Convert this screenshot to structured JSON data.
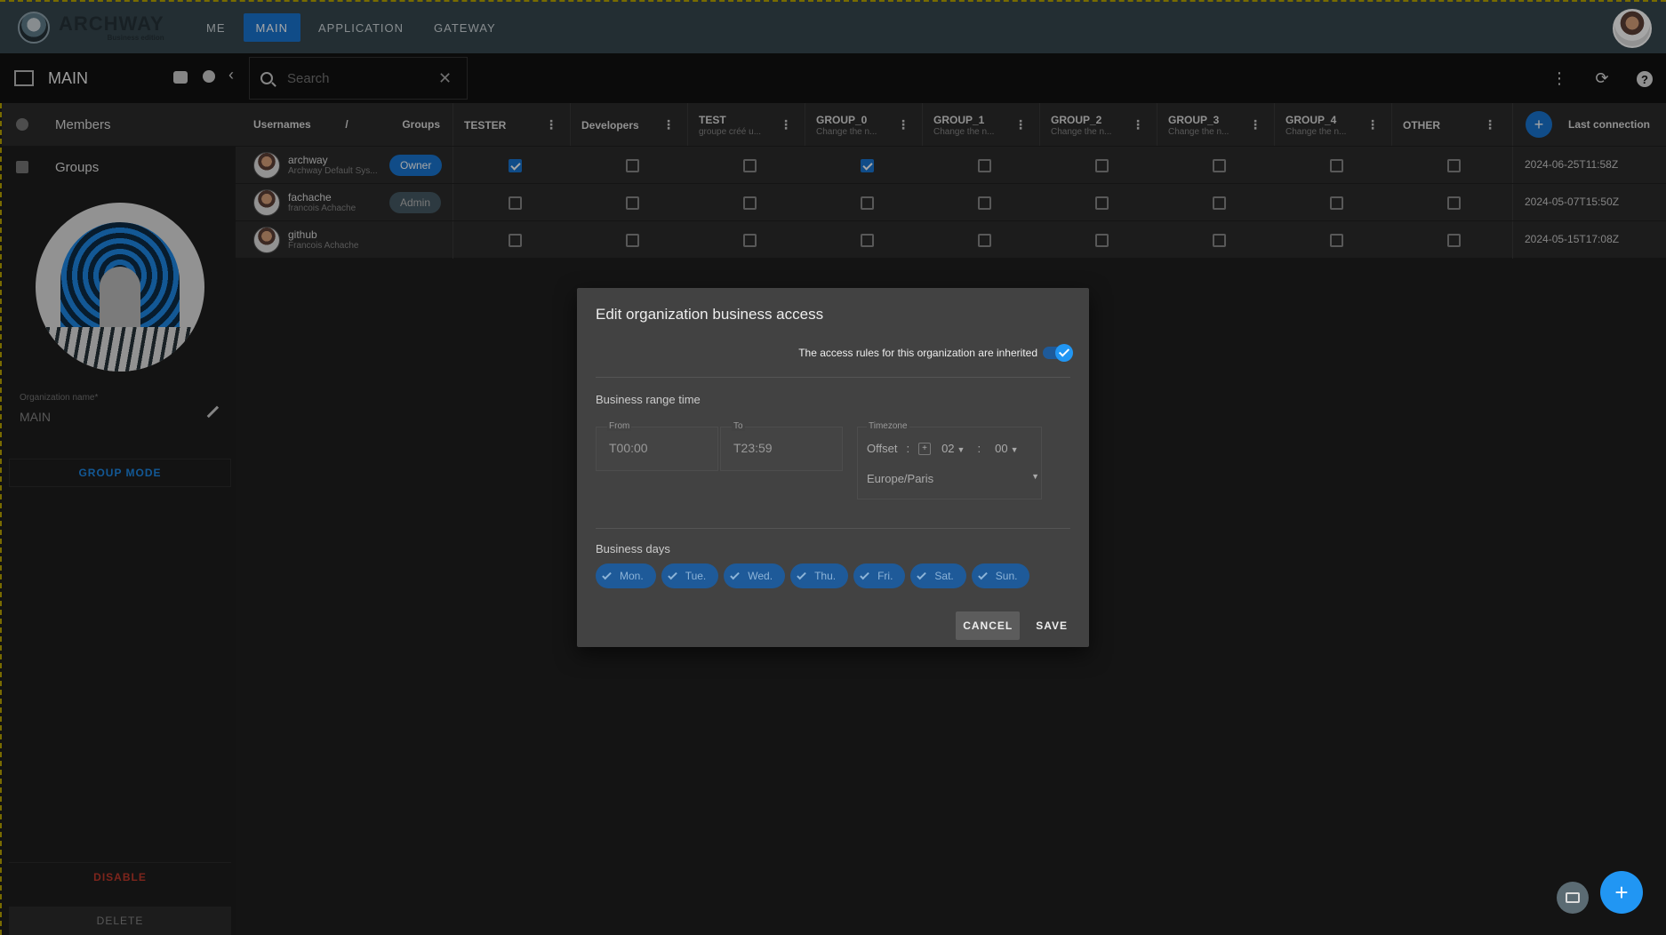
{
  "brand": {
    "name": "ARCHWAY",
    "edition": "Business edition"
  },
  "nav_tabs": [
    {
      "label": "ME"
    },
    {
      "label": "MAIN"
    },
    {
      "label": "APPLICATION"
    },
    {
      "label": "GATEWAY"
    }
  ],
  "subbar": {
    "title": "MAIN",
    "search_placeholder": "Search"
  },
  "sidebar": {
    "items": [
      {
        "label": "Members"
      },
      {
        "label": "Groups"
      }
    ],
    "org_name_label": "Organization name*",
    "org_name_value": "MAIN",
    "group_mode": "GROUP MODE",
    "disable": "DISABLE",
    "delete": "DELETE"
  },
  "table": {
    "col_usernames": "Usernames",
    "col_slash": "/",
    "col_groups": "Groups",
    "groups": [
      {
        "name": "TESTER",
        "sub": ""
      },
      {
        "name": "Developers",
        "sub": ""
      },
      {
        "name": "TEST",
        "sub": "groupe créé u..."
      },
      {
        "name": "GROUP_0",
        "sub": "Change the n..."
      },
      {
        "name": "GROUP_1",
        "sub": "Change the n..."
      },
      {
        "name": "GROUP_2",
        "sub": "Change the n..."
      },
      {
        "name": "GROUP_3",
        "sub": "Change the n..."
      },
      {
        "name": "GROUP_4",
        "sub": "Change the n..."
      },
      {
        "name": "OTHER",
        "sub": ""
      }
    ],
    "last_connection": "Last connection",
    "rows": [
      {
        "username": "archway",
        "sub": "Archway Default Sys...",
        "role": "Owner",
        "checks": [
          true,
          false,
          false,
          true,
          false,
          false,
          false,
          false,
          false
        ],
        "last": "2024-06-25T11:58Z"
      },
      {
        "username": "fachache",
        "sub": "francois Achache",
        "role": "Admin",
        "checks": [
          false,
          false,
          false,
          false,
          false,
          false,
          false,
          false,
          false
        ],
        "last": "2024-05-07T15:50Z"
      },
      {
        "username": "github",
        "sub": "Francois Achache",
        "role": "",
        "checks": [
          false,
          false,
          false,
          false,
          false,
          false,
          false,
          false,
          false
        ],
        "last": "2024-05-15T17:08Z"
      }
    ]
  },
  "dialog": {
    "title": "Edit organization business access",
    "inherited_text": "The access rules for this organization are inherited",
    "inherited": true,
    "range_title": "Business range time",
    "from_label": "From",
    "from_value": "T00:00",
    "to_label": "To",
    "to_value": "T23:59",
    "tz_label": "Timezone",
    "offset_label": "Offset",
    "offset_sign": "+",
    "offset_hours": "02",
    "offset_minutes": "00",
    "colon": ":",
    "zone": "Europe/Paris",
    "days_title": "Business days",
    "days": [
      "Mon.",
      "Tue.",
      "Wed.",
      "Thu.",
      "Fri.",
      "Sat.",
      "Sun."
    ],
    "cancel": "CANCEL",
    "save": "SAVE"
  },
  "colors": {
    "accent": "#1976d2",
    "topbar": "#37474f",
    "danger": "#c0392b"
  }
}
